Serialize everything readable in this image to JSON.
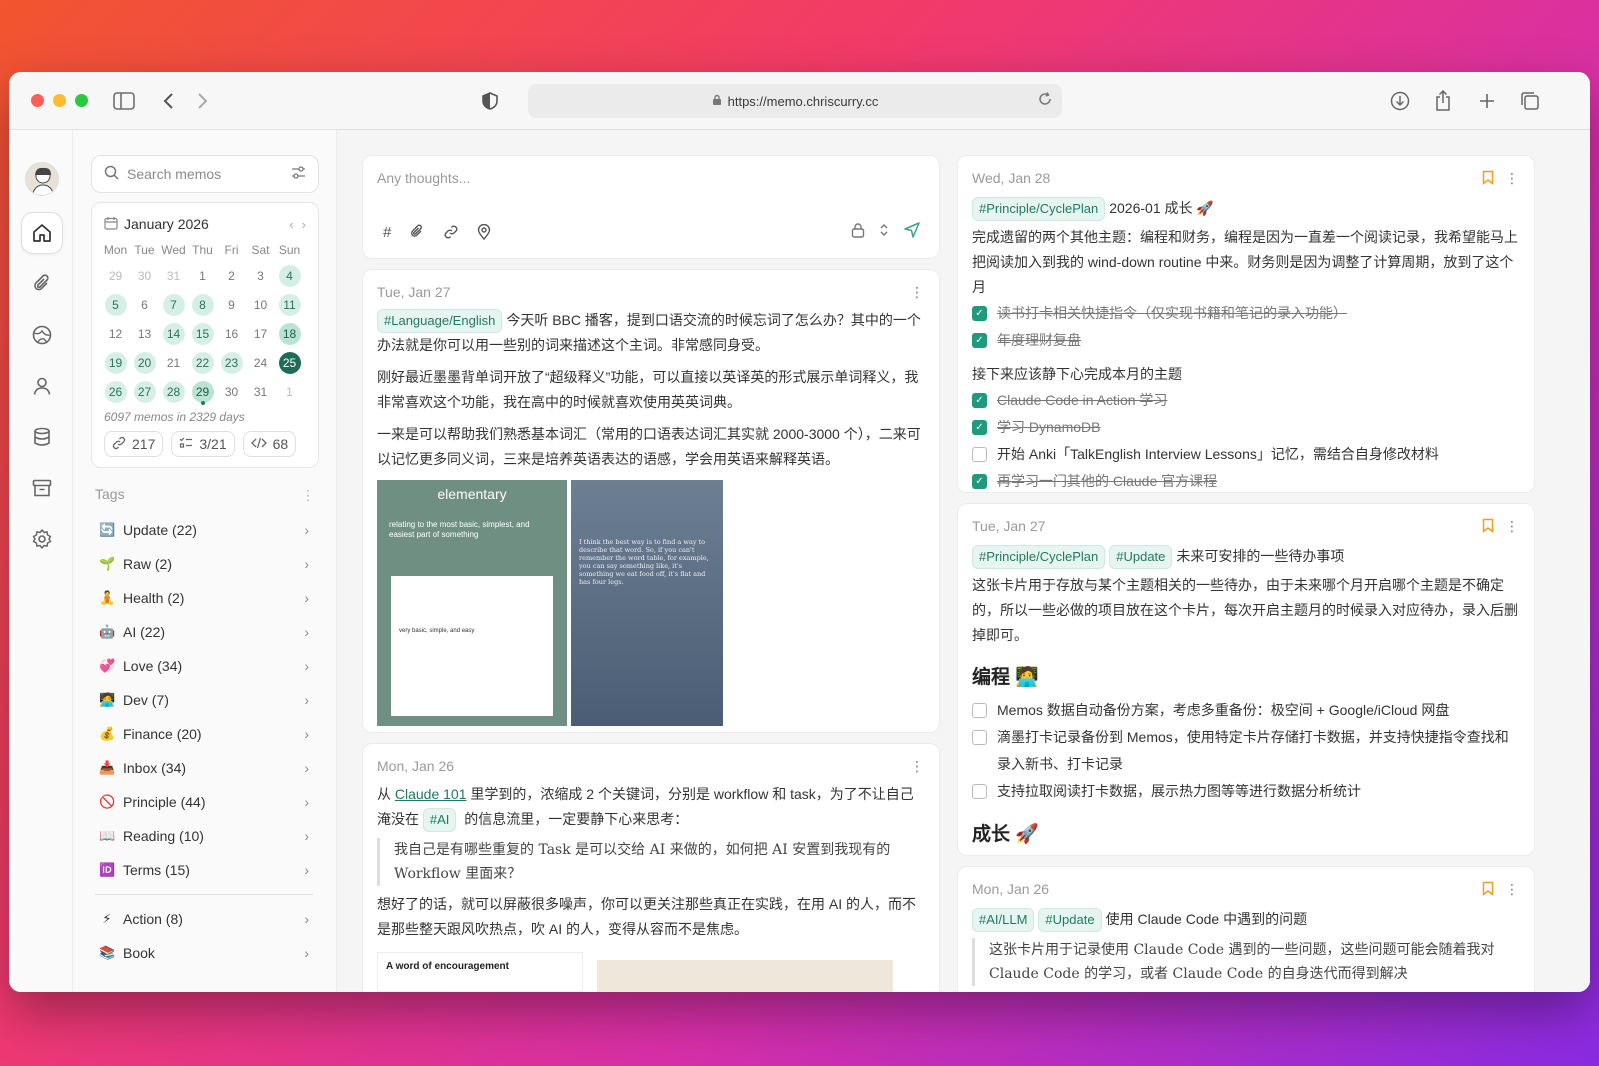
{
  "browser": {
    "url": "https://memo.chriscurry.cc"
  },
  "search": {
    "placeholder": "Search memos"
  },
  "calendar": {
    "month": "January 2026",
    "weekdays": [
      "Mon",
      "Tue",
      "Wed",
      "Thu",
      "Fri",
      "Sat",
      "Sun"
    ],
    "days": [
      {
        "d": "29",
        "lvl": "muted"
      },
      {
        "d": "30",
        "lvl": "muted"
      },
      {
        "d": "31",
        "lvl": "muted"
      },
      {
        "d": "1",
        "lvl": ""
      },
      {
        "d": "2",
        "lvl": ""
      },
      {
        "d": "3",
        "lvl": ""
      },
      {
        "d": "4",
        "lvl": "l1"
      },
      {
        "d": "5",
        "lvl": "l1"
      },
      {
        "d": "6",
        "lvl": ""
      },
      {
        "d": "7",
        "lvl": "l1"
      },
      {
        "d": "8",
        "lvl": "l1"
      },
      {
        "d": "9",
        "lvl": ""
      },
      {
        "d": "10",
        "lvl": ""
      },
      {
        "d": "11",
        "lvl": "l1"
      },
      {
        "d": "12",
        "lvl": ""
      },
      {
        "d": "13",
        "lvl": ""
      },
      {
        "d": "14",
        "lvl": "l1"
      },
      {
        "d": "15",
        "lvl": "l1"
      },
      {
        "d": "16",
        "lvl": ""
      },
      {
        "d": "17",
        "lvl": ""
      },
      {
        "d": "18",
        "lvl": "l2"
      },
      {
        "d": "19",
        "lvl": "l1"
      },
      {
        "d": "20",
        "lvl": "l1"
      },
      {
        "d": "21",
        "lvl": ""
      },
      {
        "d": "22",
        "lvl": "l1"
      },
      {
        "d": "23",
        "lvl": "l1"
      },
      {
        "d": "24",
        "lvl": ""
      },
      {
        "d": "25",
        "lvl": "today"
      },
      {
        "d": "26",
        "lvl": "l1"
      },
      {
        "d": "27",
        "lvl": "l1"
      },
      {
        "d": "28",
        "lvl": "l1"
      },
      {
        "d": "29",
        "lvl": "l2 dot"
      },
      {
        "d": "30",
        "lvl": ""
      },
      {
        "d": "31",
        "lvl": ""
      },
      {
        "d": "1",
        "lvl": "muted"
      }
    ],
    "summary": "6097 memos in 2329 days",
    "stats": {
      "links": "217",
      "todos": "3/21",
      "code": "68"
    }
  },
  "tags": {
    "title": "Tags",
    "items": [
      {
        "emoji": "🔄",
        "label": "Update (22)"
      },
      {
        "emoji": "🌱",
        "label": "Raw (2)"
      },
      {
        "emoji": "🧘",
        "label": "Health (2)"
      },
      {
        "emoji": "🤖",
        "label": "AI (22)"
      },
      {
        "emoji": "💞",
        "label": "Love (34)"
      },
      {
        "emoji": "🧑‍💻",
        "label": "Dev (7)"
      },
      {
        "emoji": "💰",
        "label": "Finance (20)"
      },
      {
        "emoji": "📥",
        "label": "Inbox (34)"
      },
      {
        "emoji": "🚫",
        "label": "Principle (44)"
      },
      {
        "emoji": "📖",
        "label": "Reading (10)"
      },
      {
        "emoji": "🆔",
        "label": "Terms (15)"
      }
    ],
    "extra": [
      {
        "emoji": "⚡",
        "label": "Action (8)"
      },
      {
        "emoji": "📚",
        "label": "Book"
      }
    ]
  },
  "editor": {
    "placeholder": "Any thoughts..."
  },
  "memo1": {
    "date": "Tue, Jan 27",
    "tag": "#Language/English",
    "p1": "今天听 BBC 播客，提到口语交流的时候忘词了怎么办？其中的一个办法就是你可以用一些别的词来描述这个主词。非常感同身受。",
    "p2": "刚好最近墨墨背单词开放了“超级释义”功能，可以直接以英译英的形式展示单词释义，我非常喜欢这个功能，我在高中的时候就喜欢使用英英词典。",
    "p3": "一来是可以帮助我们熟悉基本词汇（常用的口语表达词汇其实就 2000-3000 个），二来可以记忆更多同义词，三来是培养英语表达的语感，学会用英语来解释英语。",
    "img1_word": "elementary",
    "img1_text": "relating to the most basic, simplest, and easiest part of something",
    "img1_popup": "very basic, simple, and easy",
    "img2_text": "I think the best way is to find a way to describe that word. So, if you can't remember the word table, for example, you can say something like, it's something we eat food off, it's flat and has four legs."
  },
  "memo2": {
    "date": "Mon, Jan 26",
    "pre": "从",
    "link": "Claude 101",
    "mid": "里学到的，浓缩成 2 个关键词，分别是 workflow 和 task，为了不让自己淹没在",
    "tag": "#AI",
    "post": "的信息流里，一定要静下心来思考：",
    "quote": "我自己是有哪些重复的 Task 是可以交给 AI 来做的，如何把 AI 安置到我现有的 Workflow 里面来？",
    "p2": "想好了的话，就可以屏蔽很多噪声，你可以更关注那些真正在实践，在用 AI 的人，而不是那些整天跟风吹热点，吹 AI 的人，变得从容而不是焦虑。",
    "strip": "A word of encouragement"
  },
  "memo3": {
    "date": "Wed, Jan 28",
    "tag": "#Principle/CyclePlan",
    "title": "2026-01 成长 🚀",
    "p1": "完成遗留的两个其他主题：编程和财务，编程是因为一直差一个阅读记录，我希望能马上把阅读加入到我的 wind-down routine 中来。财务则是因为调整了计算周期，放到了这个月",
    "todos1": [
      {
        "text": "读书打卡相关快捷指令（仅实现书籍和笔记的录入功能）",
        "done": true
      },
      {
        "text": "年度理财复盘",
        "done": true
      }
    ],
    "p2": "接下来应该静下心完成本月的主题",
    "todos2": [
      {
        "text": "Claude Code in Action 学习",
        "done": true
      },
      {
        "text": "学习 DynamoDB",
        "done": true
      },
      {
        "text": "开始 Anki「TalkEnglish Interview Lessons」记忆，需结合自身修改材料",
        "done": false
      },
      {
        "text": "再学习一门其他的 Claude 官方课程",
        "done": true
      }
    ]
  },
  "memo4": {
    "date": "Tue, Jan 27",
    "tag1": "#Principle/CyclePlan",
    "tag2": "#Update",
    "title": "未来可安排的一些待办事项",
    "p1": "这张卡片用于存放与某个主题相关的一些待办，由于未来哪个月开启哪个主题是不确定的，所以一些必做的项目放在这个卡片，每次开启主题月的时候录入对应待办，录入后删掉即可。",
    "h1": "编程 🧑‍💻",
    "todos": [
      {
        "text": "Memos 数据自动备份方案，考虑多重备份：极空间 + Google/iCloud 网盘"
      },
      {
        "text": "滴墨打卡记录备份到 Memos，使用特定卡片存储打卡数据，并支持快捷指令查找和录入新书、打卡记录"
      },
      {
        "text": "支持拉取阅读打卡数据，展示热力图等等进行数据分析统计"
      }
    ],
    "h2": "成长 🚀"
  },
  "memo5": {
    "date": "Mon, Jan 26",
    "tag1": "#AI/LLM",
    "tag2": "#Update",
    "title": "使用 Claude Code 中遇到的问题",
    "quote": "这张卡片用于记录使用 Claude Code 遇到的一些问题，这些问题可能会随着我对 Claude Code 的学习，或者 Claude Code 的自身迭代而得到解决"
  }
}
